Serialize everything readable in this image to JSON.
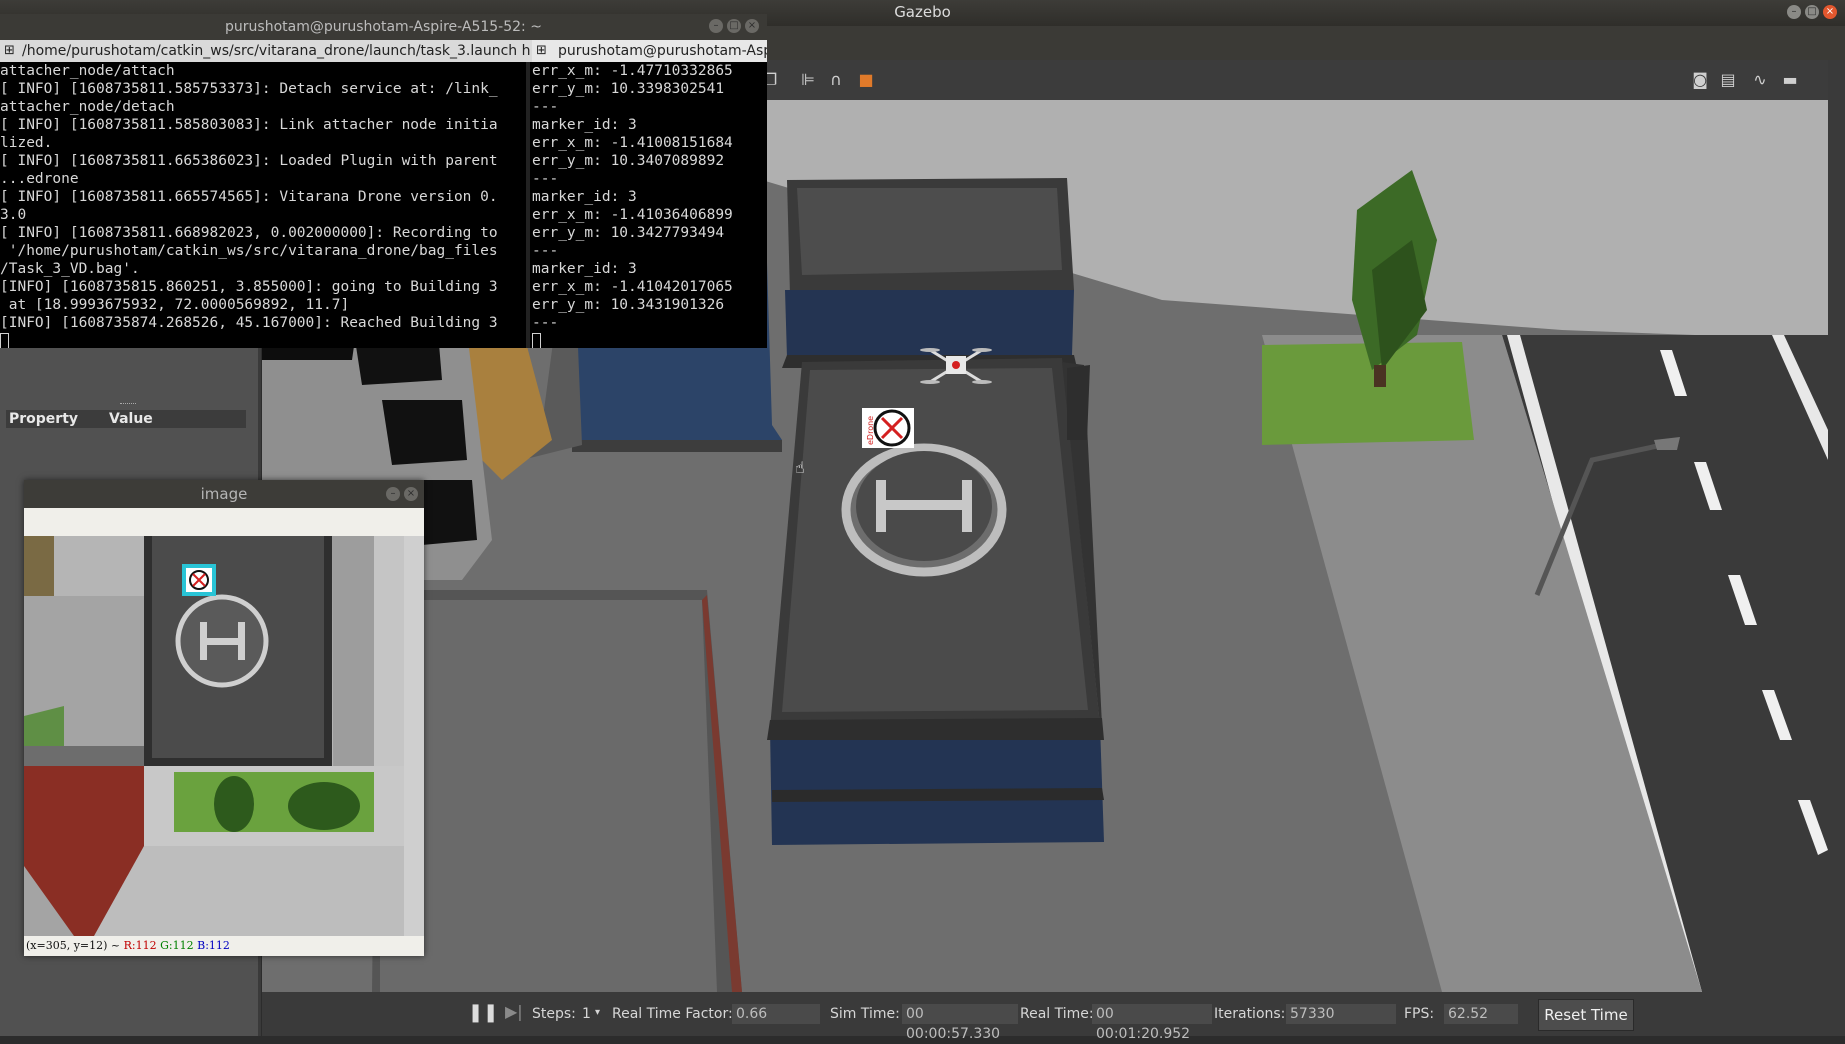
{
  "gazebo": {
    "title": "Gazebo",
    "left_panel": {
      "property_label": "Property",
      "value_label": "Value"
    },
    "bottom_bar": {
      "steps_label": "Steps:",
      "steps_value": "1",
      "rtf_label": "Real Time Factor:",
      "rtf_value": "0.66",
      "sim_time_label": "Sim Time:",
      "sim_time_value": "00 00:00:57.330",
      "real_time_label": "Real Time:",
      "real_time_value": "00 00:01:20.952",
      "iterations_label": "Iterations:",
      "iterations_value": "57330",
      "fps_label": "FPS:",
      "fps_value": "62.52",
      "reset_label": "Reset Time"
    }
  },
  "terminal": {
    "title": "purushotam@purushotam-Aspire-A515-52: ~",
    "tab1": "/home/purushotam/catkin_ws/src/vitarana_drone/launch/task_3.launch htt",
    "tab2": "purushotam@purushotam-Asp",
    "left_lines": [
      "attacher_node/attach",
      "[ INFO] [1608735811.585753373]: Detach service at: /link_",
      "attacher_node/detach",
      "[ INFO] [1608735811.585803083]: Link attacher node initia",
      "lized.",
      "[ INFO] [1608735811.665386023]: Loaded Plugin with parent",
      "...edrone",
      "[ INFO] [1608735811.665574565]: Vitarana Drone version 0.",
      "3.0",
      "[ INFO] [1608735811.668982023, 0.002000000]: Recording to",
      " '/home/purushotam/catkin_ws/src/vitarana_drone/bag_files",
      "/Task_3_VD.bag'.",
      "[INFO] [1608735815.860251, 3.855000]: going to Building 3",
      " at [18.9993675932, 72.0000569892, 11.7]",
      "[INFO] [1608735874.268526, 45.167000]: Reached Building 3"
    ],
    "right_lines": [
      "err_x_m: -1.47710332865",
      "err_y_m: 10.3398302541",
      "---",
      "marker_id: 3",
      "err_x_m: -1.41008151684",
      "err_y_m: 10.3407089892",
      "---",
      "marker_id: 3",
      "err_x_m: -1.41036406899",
      "err_y_m: 10.3427793494",
      "---",
      "marker_id: 3",
      "err_x_m: -1.41042017065",
      "err_y_m: 10.3431901326",
      "---"
    ]
  },
  "image_window": {
    "title": "image",
    "status_pos": "(x=305, y=12) ~",
    "status_r": "R:112",
    "status_g": "G:112",
    "status_b": "B:112"
  },
  "marker_label": "eDrone",
  "colors": {
    "terminal_bg": "#000000",
    "ground": "#6e6e6e",
    "roof": "#4a4a4a",
    "grass": "#6a9a3c",
    "building_blue": "#243452",
    "marker_red": "#d42020",
    "detection_box": "#29c4d6"
  }
}
